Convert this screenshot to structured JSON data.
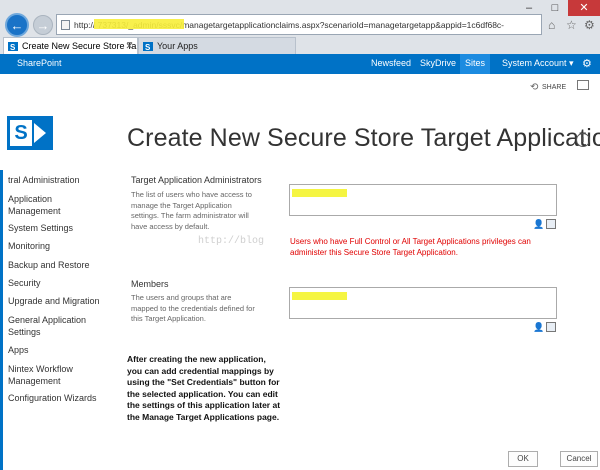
{
  "browser": {
    "url": "http://                 737313/_admin/sssvc/managetargetapplicationclaims.aspx?scenarioId=managetargetapp&appid=1c6df68c-",
    "tabs": [
      {
        "label": "Create New Secure Store Ta..."
      },
      {
        "label": "Your Apps"
      }
    ],
    "window_controls": {
      "minimize": "–",
      "maximize": "□",
      "close": "✕"
    }
  },
  "suite_bar": {
    "brand": "SharePoint",
    "links": [
      "Newsfeed",
      "SkyDrive",
      "Sites"
    ],
    "active_link": "Sites",
    "account": "System Account ▾"
  },
  "ribbon": {
    "share_label": "SHARE"
  },
  "page": {
    "title": "Create New Secure Store Target Application"
  },
  "left_nav": {
    "items": [
      "tral Administration",
      "Application Management",
      "System Settings",
      "Monitoring",
      "Backup and Restore",
      "Security",
      "Upgrade and Migration",
      "General Application Settings",
      "Apps",
      "Nintex Workflow Management",
      "Configuration Wizards"
    ]
  },
  "form": {
    "admins": {
      "title": "Target Application Administrators",
      "description": "The list of users who have access to manage the Target Application settings. The farm administrator will have access by default.",
      "error": "Users who have Full Control or All Target Applications privileges can administer this Secure Store Target Application."
    },
    "members": {
      "title": "Members",
      "description": "The users and groups that are mapped to the credentials defined for this Target Application."
    },
    "note": "After creating the new application, you can add credential mappings by using the \"Set Credentials\" button for the selected application. You can edit the settings of this application later at the Manage Target Applications page.",
    "ok_label": "OK",
    "cancel_label": "Cancel"
  },
  "watermark": "http://blog",
  "colors": {
    "brand": "#0072c6",
    "error": "#e00000",
    "redaction": "#f5f542"
  }
}
